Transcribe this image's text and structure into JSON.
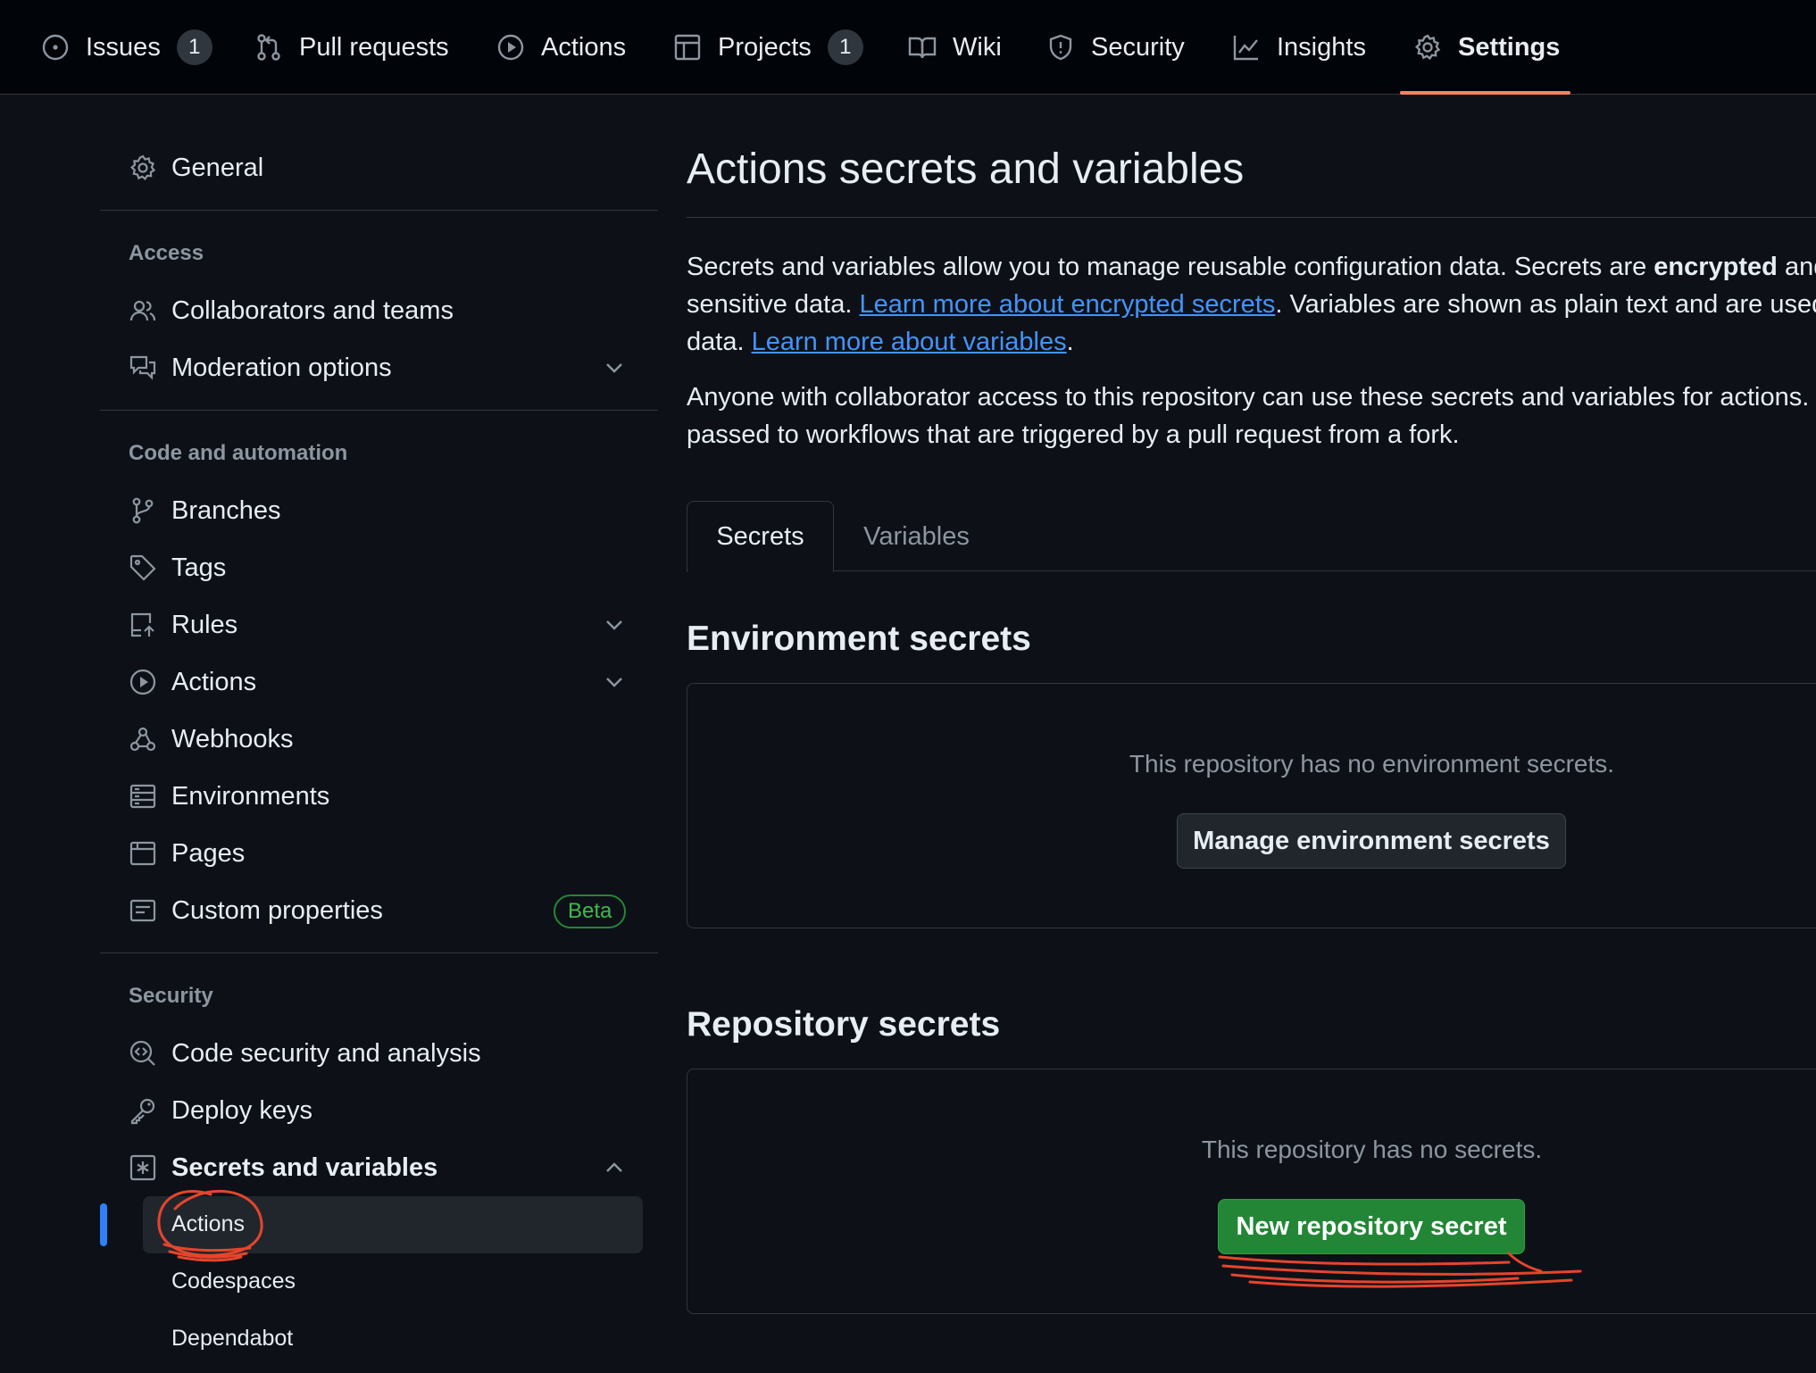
{
  "topnav": {
    "tabs": [
      {
        "label": "Issues",
        "count": "1",
        "icon": "issue-opened-icon"
      },
      {
        "label": "Pull requests",
        "icon": "git-pull-request-icon"
      },
      {
        "label": "Actions",
        "icon": "play-icon"
      },
      {
        "label": "Projects",
        "count": "1",
        "icon": "table-icon"
      },
      {
        "label": "Wiki",
        "icon": "book-icon"
      },
      {
        "label": "Security",
        "icon": "shield-icon"
      },
      {
        "label": "Insights",
        "icon": "graph-icon"
      },
      {
        "label": "Settings",
        "icon": "gear-icon",
        "active": true
      }
    ]
  },
  "sidebar": {
    "general": "General",
    "access_heading": "Access",
    "collaborators": "Collaborators and teams",
    "moderation": "Moderation options",
    "code_heading": "Code and automation",
    "branches": "Branches",
    "tags": "Tags",
    "rules": "Rules",
    "actions": "Actions",
    "webhooks": "Webhooks",
    "environments": "Environments",
    "pages": "Pages",
    "custom_properties": "Custom properties",
    "beta_badge": "Beta",
    "security_heading": "Security",
    "code_security": "Code security and analysis",
    "deploy_keys": "Deploy keys",
    "secrets_variables": "Secrets and variables",
    "sub_actions": "Actions",
    "sub_codespaces": "Codespaces",
    "sub_dependabot": "Dependabot"
  },
  "main": {
    "title": "Actions secrets and variables",
    "p1_a": "Secrets and variables allow you to manage reusable configuration data. Secrets are ",
    "p1_b": "encrypted",
    "p1_c": " and",
    "p1_d": "sensitive data. ",
    "p1_link1": "Learn more about encrypted secrets",
    "p1_e": ". Variables are shown as plain text and are used",
    "p1_f": "data. ",
    "p1_link2": "Learn more about variables",
    "p1_g": ".",
    "p2_a": "Anyone with collaborator access to this repository can use these secrets and variables for actions.",
    "p2_b": "passed to workflows that are triggered by a pull request from a fork.",
    "tab_secrets": "Secrets",
    "tab_variables": "Variables",
    "env_title": "Environment secrets",
    "env_empty": "This repository has no environment secrets.",
    "env_button": "Manage environment secrets",
    "repo_title": "Repository secrets",
    "repo_empty": "This repository has no secrets.",
    "repo_button": "New repository secret"
  },
  "colors": {
    "accent_blue": "#4493f8",
    "tab_underline": "#f78166",
    "primary_button": "#238636",
    "annotation_red": "#e5452c"
  }
}
